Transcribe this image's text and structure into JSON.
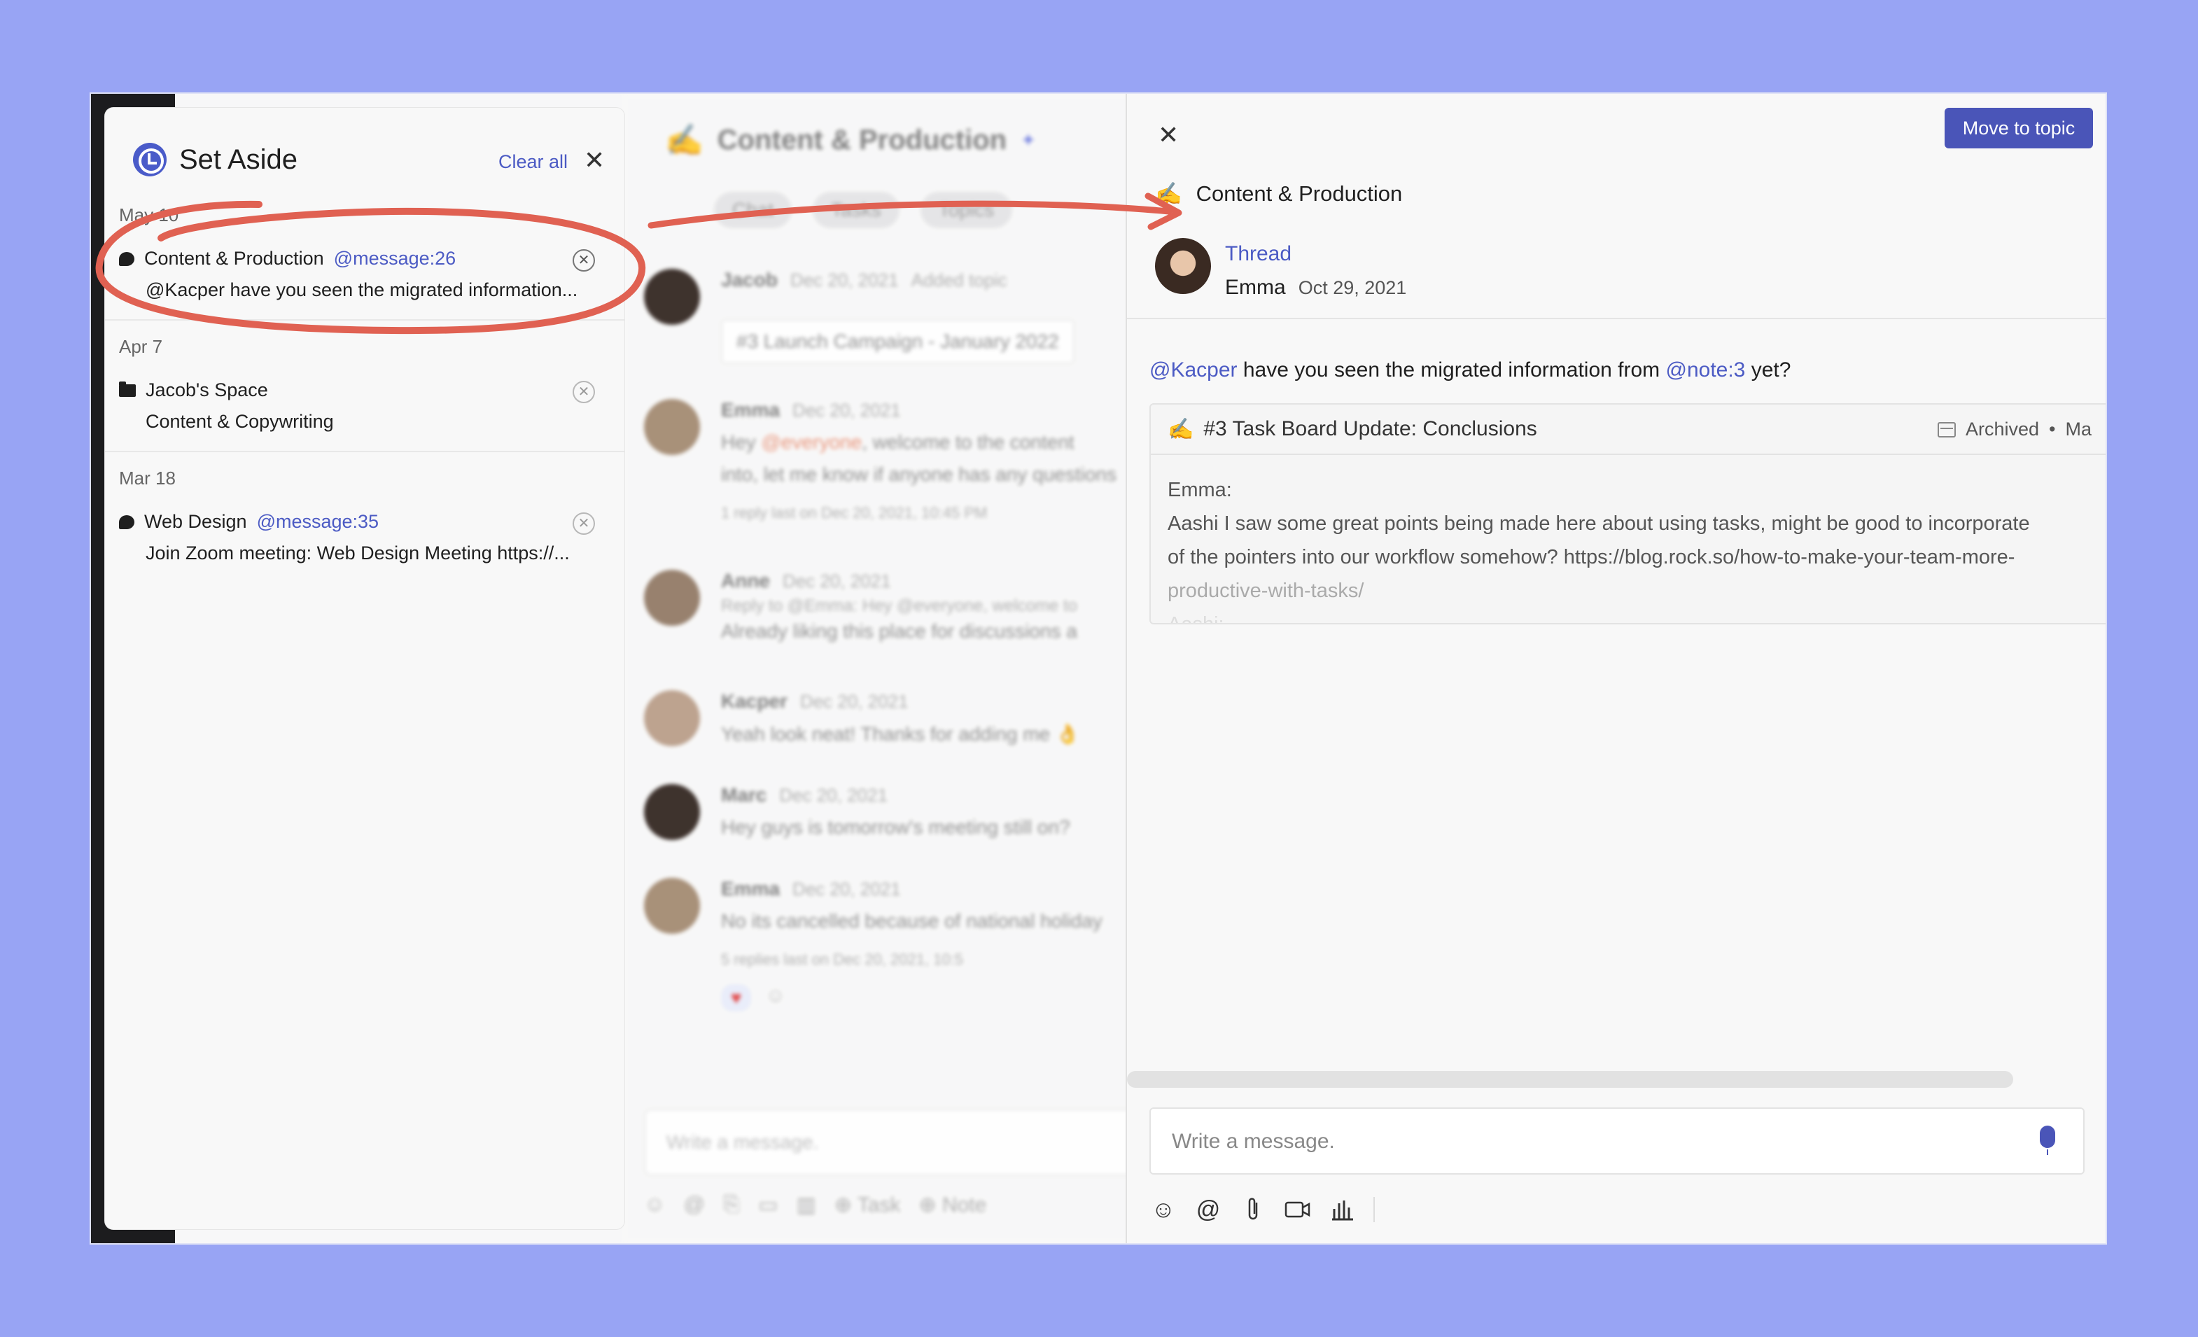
{
  "set_aside": {
    "title": "Set Aside",
    "clear_all": "Clear all",
    "groups": [
      {
        "date": "May 10",
        "items": [
          {
            "topic": "Content & Production",
            "mention": "@message:26",
            "text": "@Kacper have you seen the migrated information..."
          }
        ]
      },
      {
        "date": "Apr 7",
        "items": [
          {
            "topic": "Jacob's Space",
            "mention": "",
            "text": "Content & Copywriting"
          }
        ]
      },
      {
        "date": "Mar 18",
        "items": [
          {
            "topic": "Web Design",
            "mention": "@message:35",
            "text": "Join Zoom meeting: Web Design Meeting https://..."
          }
        ]
      }
    ]
  },
  "chat": {
    "emoji": "✍️",
    "title": "Content & Production",
    "tabs": [
      "Chat",
      "Tasks",
      "Topics"
    ],
    "messages": [
      {
        "name": "Jacob",
        "date": "Dec 20, 2021",
        "extra": "Added topic",
        "text": "#3 Launch Campaign - January 2022"
      },
      {
        "name": "Emma",
        "date": "Dec 20, 2021",
        "text_pre": "Hey ",
        "text_hl": "@everyone",
        "text_post": ", welcome to the content",
        "text2": "into, let me know if anyone has any questions",
        "replies": "1 reply   last on Dec 20, 2021, 10:45 PM"
      },
      {
        "name": "Anne",
        "date": "Dec 20, 2021",
        "reply": "Reply to @Emma: Hey @everyone, welcome to",
        "text": "Already liking this place for discussions a"
      },
      {
        "name": "Kacper",
        "date": "Dec 20, 2021",
        "text": "Yeah look neat! Thanks for adding me 👌"
      },
      {
        "name": "Marc",
        "date": "Dec 20, 2021",
        "text": "Hey guys is tomorrow's meeting still on?"
      },
      {
        "name": "Emma",
        "date": "Dec 20, 2021",
        "text": "No its cancelled because of national holiday",
        "replies": "5 replies   last on Dec 20, 2021, 10:5"
      }
    ],
    "input_placeholder": "Write a message.",
    "tools": [
      "Task",
      "Note"
    ]
  },
  "thread": {
    "move_to_topic": "Move to topic",
    "topic_emoji": "✍️",
    "topic": "Content & Production",
    "thread_label": "Thread",
    "author": "Emma",
    "date": "Oct 29, 2021",
    "message": {
      "m1": "@Kacper",
      "t1": " have you seen the migrated information from ",
      "m2": "@note:3",
      "t2": " yet?"
    },
    "card": {
      "emoji": "✍️",
      "title": "#3 Task Board Update: Conclusions",
      "status": "Archived",
      "status_extra": "Ma",
      "lines": [
        "Emma:",
        "Aashi I saw some great points being made here about using tasks, might be good to incorporate",
        "of the pointers into our workflow somehow? https://blog.rock.so/how-to-make-your-team-more-",
        "productive-with-tasks/",
        "Aashi:"
      ]
    },
    "input_placeholder": "Write a message."
  },
  "colors": {
    "background": "#98a4f4",
    "accent": "#4a55b8",
    "annotation": "#e06152"
  }
}
